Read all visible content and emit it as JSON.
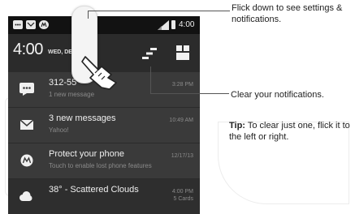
{
  "status_bar": {
    "time": "4:00"
  },
  "header": {
    "time": "4:00",
    "date": "WED, DE      18"
  },
  "notifications": [
    {
      "icon": "chat-icon",
      "title": "312-55",
      "subtitle": "1 new message",
      "time": "3:28 PM",
      "time2": ""
    },
    {
      "icon": "mail-icon",
      "title": "3 new messages",
      "subtitle": "Yahoo!",
      "time": "10:49 AM",
      "time2": ""
    },
    {
      "icon": "motorola-icon",
      "title": "Protect your phone",
      "subtitle": "Touch to enable lost phone features",
      "time": "12/17/13",
      "time2": ""
    },
    {
      "icon": "cloud-icon",
      "title": "38° - Scattered Clouds",
      "subtitle": "",
      "time": "4:00 PM",
      "time2": "5 Cards"
    }
  ],
  "callouts": {
    "swipe": "Flick down to see settings & notifications.",
    "clear": "Clear your notifications.",
    "tip_label": "Tip:",
    "tip_text": " To clear just one, flick it to the left or right."
  },
  "colors": {
    "panel": "#2b2b2b",
    "card": "#3a3a3a",
    "statusbar": "#121212",
    "icon_tile": "#3d5c63"
  }
}
